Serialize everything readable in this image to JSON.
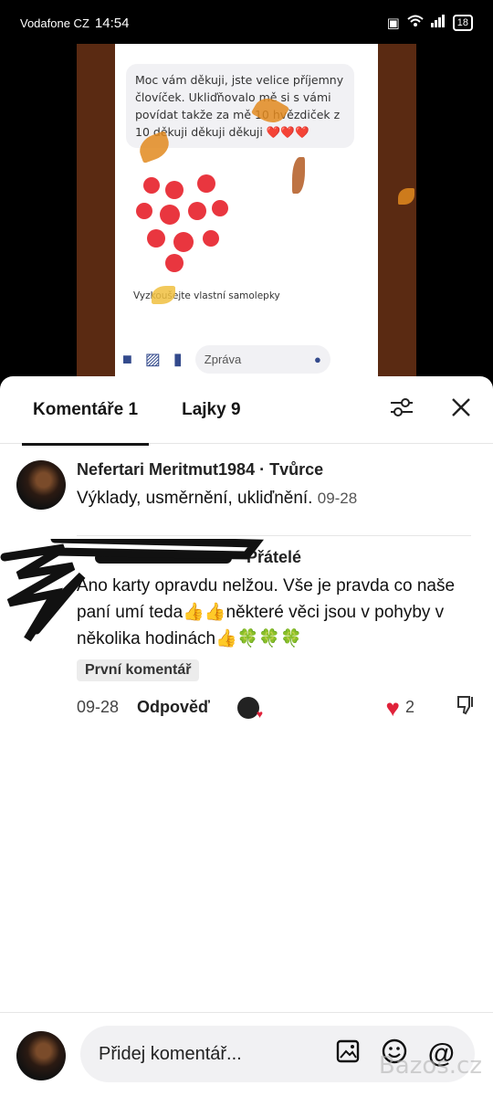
{
  "status_bar": {
    "carrier": "Vodafone CZ",
    "time": "14:54",
    "battery": "18"
  },
  "video": {
    "message_text": "Moc vám děkuji, jste velice příjemny človíček. Ukliďňovalo mě si s vámi povídat takže za mě 10 hvězdiček z 10 děkuji děkuji děkuji ❤️❤️❤️",
    "sticker_hint": "Vyzkoušejte vlastní samolepky",
    "input_placeholder": "Zpráva"
  },
  "tabs": [
    {
      "label": "Komentáře 1",
      "active": true
    },
    {
      "label": "Lajky 9",
      "active": false
    }
  ],
  "comments": [
    {
      "author": "Nefertari Meritmut1984 · Tvůrce",
      "text": "Výklady, usměrnění, ukliďnění.",
      "date": "09-28"
    },
    {
      "author": "· Přátelé",
      "text": "Ano karty opravdu nelžou. Vše je pravda co naše paní umí teda👍👍některé věci jsou v pohyby v několika hodinách👍🍀🍀🍀",
      "badge": "První komentář",
      "date": "09-28",
      "reply_label": "Odpověď",
      "likes": "2"
    }
  ],
  "bottom": {
    "placeholder": "Přidej komentář..."
  },
  "watermark": "Bazos.cz",
  "colors": {
    "heart": "#e0223a",
    "leaf": "#e28a1f",
    "sheet_bg": "#ffffff"
  }
}
